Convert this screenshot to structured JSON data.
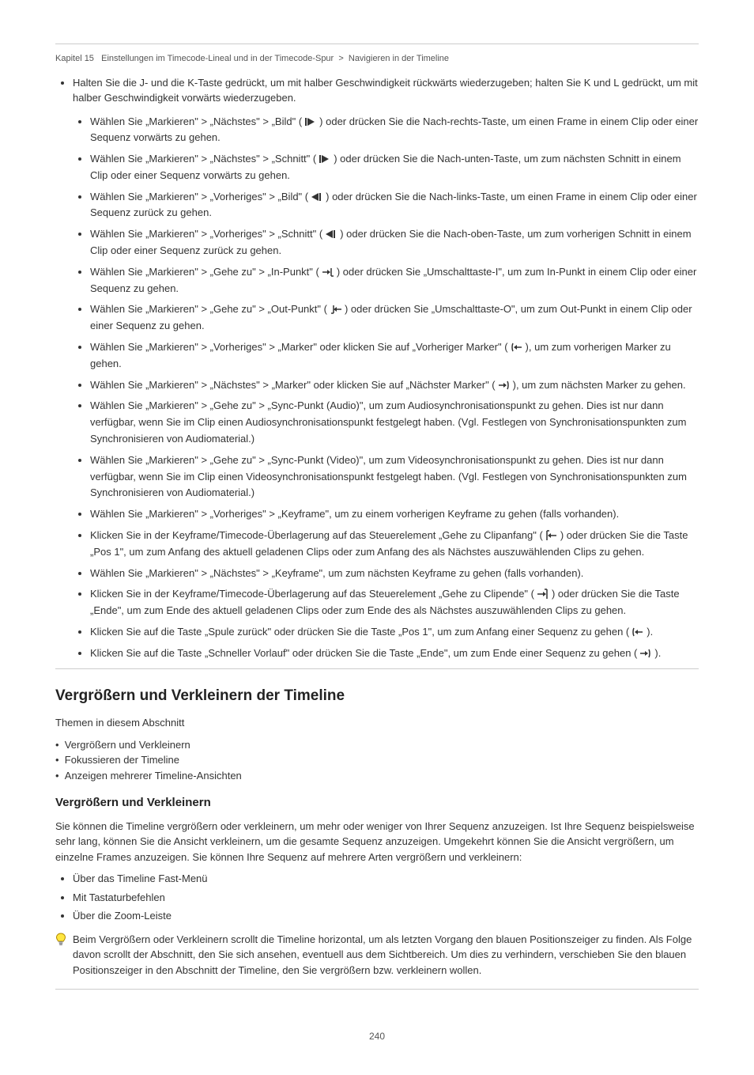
{
  "header": {
    "left": "",
    "right": ""
  },
  "breadcrumb": {
    "a": "Kapitel 15",
    "b": "Einstellungen im Timecode-Lineal und in der Timecode-Spur",
    "c": "Navigieren in der Timeline"
  },
  "section1": {
    "intro": "Halten Sie die J- und die K-Taste gedrückt, um mit halber Geschwindigkeit rückwärts wiederzugeben; halten Sie K und L gedrückt, um mit halber Geschwindigkeit vorwärts wiederzugeben.",
    "bullets": [
      {
        "pre": "Wählen Sie „Markieren\" > „Nächstes\" > „Bild\" (",
        "post": ") oder drücken Sie die Nach-rechts-Taste, um einen Frame in einem Clip oder einer Sequenz vorwärts zu gehen.",
        "icon": "step-fwd"
      },
      {
        "pre": "Wählen Sie „Markieren\" > „Nächstes\" > „Schnitt\" (",
        "post": ") oder drücken Sie die Nach-unten-Taste, um zum nächsten Schnitt in einem Clip oder einer Sequenz vorwärts zu gehen.",
        "icon": "next-edit"
      },
      {
        "pre": "Wählen Sie „Markieren\" > „Vorheriges\" > „Bild\" (",
        "post": ") oder drücken Sie die Nach-links-Taste, um einen Frame in einem Clip oder einer Sequenz zurück zu gehen.",
        "icon": "step-back"
      },
      {
        "pre": "Wählen Sie „Markieren\" > „Vorheriges\" > „Schnitt\" (",
        "post": ") oder drücken Sie die Nach-oben-Taste, um zum vorherigen Schnitt in einem Clip oder einer Sequenz zurück zu gehen.",
        "icon": "prev-edit"
      },
      {
        "pre": "Wählen Sie „Markieren\" > „Gehe zu\" > „In-Punkt\" (",
        "post": ") oder drücken Sie „Umschalttaste-I\", um zum In-Punkt in einem Clip oder einer Sequenz zu gehen.",
        "icon": "goto-in"
      },
      {
        "pre": "Wählen Sie „Markieren\" > „Gehe zu\" > „Out-Punkt\" (",
        "post": ") oder drücken Sie „Umschalttaste-O\", um zum Out-Punkt in einem Clip oder einer Sequenz zu gehen.",
        "icon": "goto-out"
      },
      {
        "pre": "Wählen Sie „Markieren\" > „Vorheriges\" > „Marker\" oder klicken Sie auf „Vorheriger Marker\" (",
        "post": "), um zum vorherigen Marker zu gehen.",
        "icon": "prev-marker"
      },
      {
        "pre": "Wählen Sie „Markieren\" > „Nächstes\" > „Marker\" oder klicken Sie auf „Nächster Marker\" (",
        "post": "), um zum nächsten Marker zu gehen.",
        "icon": "next-marker"
      },
      {
        "text": "Wählen Sie „Markieren\" > „Gehe zu\" > „Sync-Punkt (Audio)\", um zum Audiosynchronisationspunkt zu gehen. Dies ist nur dann verfügbar, wenn Sie im Clip einen Audiosynchronisationspunkt festgelegt haben. (Vgl. Festlegen von Synchronisationspunkten zum Synchronisieren von Audiomaterial.)"
      },
      {
        "text": "Wählen Sie „Markieren\" > „Gehe zu\" > „Sync-Punkt (Video)\", um zum Videosynchronisationspunkt zu gehen. Dies ist nur dann verfügbar, wenn Sie im Clip einen Videosynchronisationspunkt festgelegt haben. (Vgl. Festlegen von Synchronisationspunkten zum Synchronisieren von Audiomaterial.)"
      },
      {
        "text": "Wählen Sie „Markieren\" > „Vorheriges\" > „Keyframe\", um zu einem vorherigen Keyframe zu gehen (falls vorhanden)."
      },
      {
        "pre": "Klicken Sie in der Keyframe/Timecode-Überlagerung auf das Steuerelement „Gehe zu Clipanfang\" (",
        "post": ") oder drücken Sie die Taste „Pos 1\", um zum Anfang des aktuell geladenen Clips oder zum Anfang des als Nächstes auszuwählenden Clips zu gehen.",
        "icon": "clip-start"
      },
      {
        "text": "Wählen Sie „Markieren\" > „Nächstes\" > „Keyframe\", um zum nächsten Keyframe zu gehen (falls vorhanden)."
      },
      {
        "pre": "Klicken Sie in der Keyframe/Timecode-Überlagerung auf das Steuerelement „Gehe zu Clipende\" (",
        "post": ") oder drücken Sie die Taste „Ende\", um zum Ende des aktuell geladenen Clips oder zum Ende des als Nächstes auszuwählenden Clips zu gehen.",
        "icon": "clip-end"
      },
      {
        "pre": "Klicken Sie auf die Taste „Spule zurück\" oder drücken Sie die Taste „Pos 1\", um zum Anfang einer Sequenz zu gehen (",
        "post": ").",
        "icon": "rewind"
      },
      {
        "pre": "Klicken Sie auf die Taste „Schneller Vorlauf\" oder drücken Sie die Taste „Ende\", um zum Ende einer Sequenz zu gehen (",
        "post": ").",
        "icon": "ffwd"
      }
    ]
  },
  "section2": {
    "title": "Vergrößern und Verkleinern der Timeline",
    "toc_label": "Themen in diesem Abschnitt",
    "toc": [
      "Vergrößern und Verkleinern",
      "Fokussieren der Timeline",
      "Anzeigen mehrerer Timeline-Ansichten"
    ],
    "sub_title": "Vergrößern und Verkleinern",
    "p1": "Sie können die Timeline vergrößern oder verkleinern, um mehr oder weniger von Ihrer Sequenz anzuzeigen. Ist Ihre Sequenz beispielsweise sehr lang, können Sie die Ansicht verkleinern, um die gesamte Sequenz anzuzeigen. Umgekehrt können Sie die Ansicht vergrößern, um einzelne Frames anzuzeigen. Sie können Ihre Sequenz auf mehrere Arten vergrößern und verkleinern:",
    "items": [
      "Über das Timeline Fast-Menü",
      "Mit Tastaturbefehlen",
      "Über die Zoom-Leiste"
    ],
    "tip": "Beim Vergrößern oder Verkleinern scrollt die Timeline horizontal, um als letzten Vorgang den blauen Positionszeiger zu finden. Als Folge davon scrollt der Abschnitt, den Sie sich ansehen, eventuell aus dem Sichtbereich. Um dies zu verhindern, verschieben Sie den blauen Positionszeiger in den Abschnitt der Timeline, den Sie vergrößern bzw. verkleinern wollen."
  },
  "page_number": "240"
}
